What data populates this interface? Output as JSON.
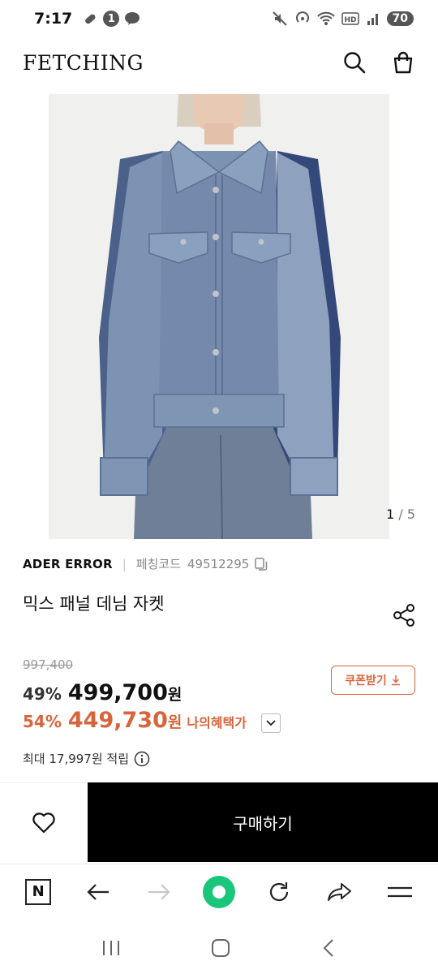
{
  "status": {
    "time": "7:17",
    "notif_count": "1",
    "talk": "TALK",
    "battery": "70"
  },
  "header": {
    "brand": "FETCHING",
    "search_icon": "search-icon",
    "bag_icon": "shopping-bag-icon"
  },
  "gallery": {
    "current": "1",
    "total": " / 5"
  },
  "product": {
    "brand": "ADER ERROR",
    "code_label": "페칭코드",
    "code_value": "49512295",
    "title": "믹스 패널 데님 자켓",
    "original_price": "997,400",
    "discount": "49%",
    "price": "499,700",
    "currency": "원",
    "coupon_label": "쿠폰받기",
    "benefit_discount": "54%",
    "benefit_price": "449,730",
    "benefit_label": "나의혜택가",
    "points": "최대 17,997원 적립"
  },
  "actions": {
    "buy_label": "구매하기"
  },
  "colors": {
    "accent": "#d7643c",
    "buy_bg": "#000000",
    "browser_green": "#19c67a"
  }
}
